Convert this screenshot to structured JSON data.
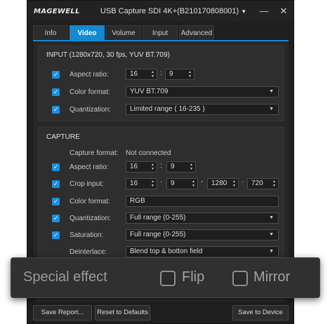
{
  "app": {
    "logo": "MAGEWELL",
    "title": "USB Capture SDI 4K+(B210170808001)"
  },
  "tabs": [
    "Info",
    "Video",
    "Volume",
    "Input",
    "Advanced"
  ],
  "active_tab": "Video",
  "input_section": {
    "title": "INPUT (1280x720, 30 fps, YUV BT.709)",
    "aspect_ratio": {
      "label": "Aspect ratio:",
      "w": "16",
      "h": "9",
      "checked": true
    },
    "color_format": {
      "label": "Color format:",
      "value": "YUV BT.709",
      "checked": true
    },
    "quantization": {
      "label": "Quantization:",
      "value": "Limited range ( 16-235 )",
      "checked": true
    }
  },
  "capture_section": {
    "title": "CAPTURE",
    "capture_format": {
      "label": "Capture format:",
      "value": "Not connected"
    },
    "aspect_ratio": {
      "label": "Aspect ratio:",
      "w": "16",
      "h": "9",
      "checked": true
    },
    "crop_input": {
      "label": "Crop input:",
      "v1": "16",
      "v2": "9",
      "v3": "1280",
      "v4": "720",
      "checked": true
    },
    "color_format": {
      "label": "Color format:",
      "value": "RGB",
      "checked": true
    },
    "quantization": {
      "label": "Quantization:",
      "value": "Full range (0-255)",
      "checked": true
    },
    "saturation": {
      "label": "Saturation:",
      "value": "Full range (0-255)",
      "checked": true
    },
    "deinterlace": {
      "label": "Deinterlace:",
      "value": "Blend top & botton field"
    }
  },
  "buttons": {
    "save_report": "Save Report...",
    "reset": "Reset to Defaults",
    "save_device": "Save to Device"
  },
  "overlay": {
    "title": "Special effect",
    "flip": "Flip",
    "mirror": "Mirror"
  },
  "colors": {
    "accent": "#1589d1",
    "checkbox": "#1b8fe0",
    "background": "#1f1f1f"
  },
  "icons": {
    "minimize": "minimize-icon",
    "close": "close-icon",
    "dropdown": "chevron-down-icon",
    "check": "checkmark-icon",
    "spinner": "spinner-arrows-icon"
  }
}
